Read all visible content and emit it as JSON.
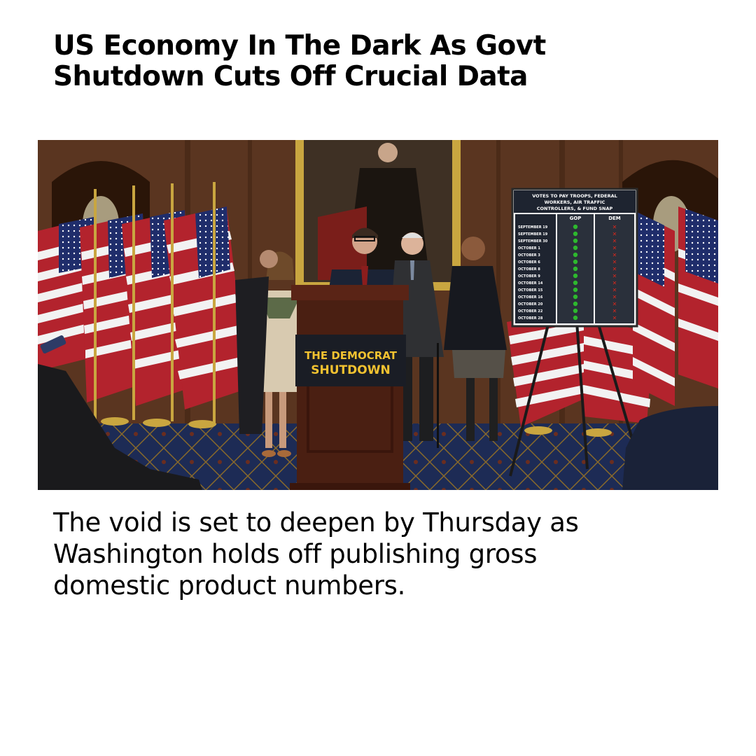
{
  "article": {
    "headline_line1": "US Economy In The Dark As Govt",
    "headline_line2": "Shutdown Cuts Off Crucial Data",
    "caption_line1": "The void is set to deepen by Thursday as",
    "caption_line2": "Washington holds off publishing gross",
    "caption_line3": "domestic product numbers."
  },
  "photo": {
    "podium_sign": {
      "line1": "THE DEMOCRAT",
      "line2": "SHUTDOWN"
    },
    "vote_board": {
      "title_line1": "VOTES TO PAY TROOPS, FEDERAL",
      "title_line2": "WORKERS, AIR TRAFFIC",
      "title_line3": "CONTROLLERS, & FUND SNAP",
      "col_gop": "GOP",
      "col_dem": "DEM",
      "dates": [
        "SEPTEMBER 19",
        "SEPTEMBER 19",
        "SEPTEMBER 30",
        "OCTOBER 1",
        "OCTOBER 3",
        "OCTOBER 6",
        "OCTOBER 8",
        "OCTOBER 9",
        "OCTOBER 14",
        "OCTOBER 15",
        "OCTOBER 16",
        "OCTOBER 20",
        "OCTOBER 22",
        "OCTOBER 28"
      ]
    }
  },
  "colors": {
    "wall": "#5a3520",
    "podium": "#4a1f12",
    "check": "#2eb82e",
    "cross": "#d9281c",
    "sign_text": "#f2c230"
  }
}
